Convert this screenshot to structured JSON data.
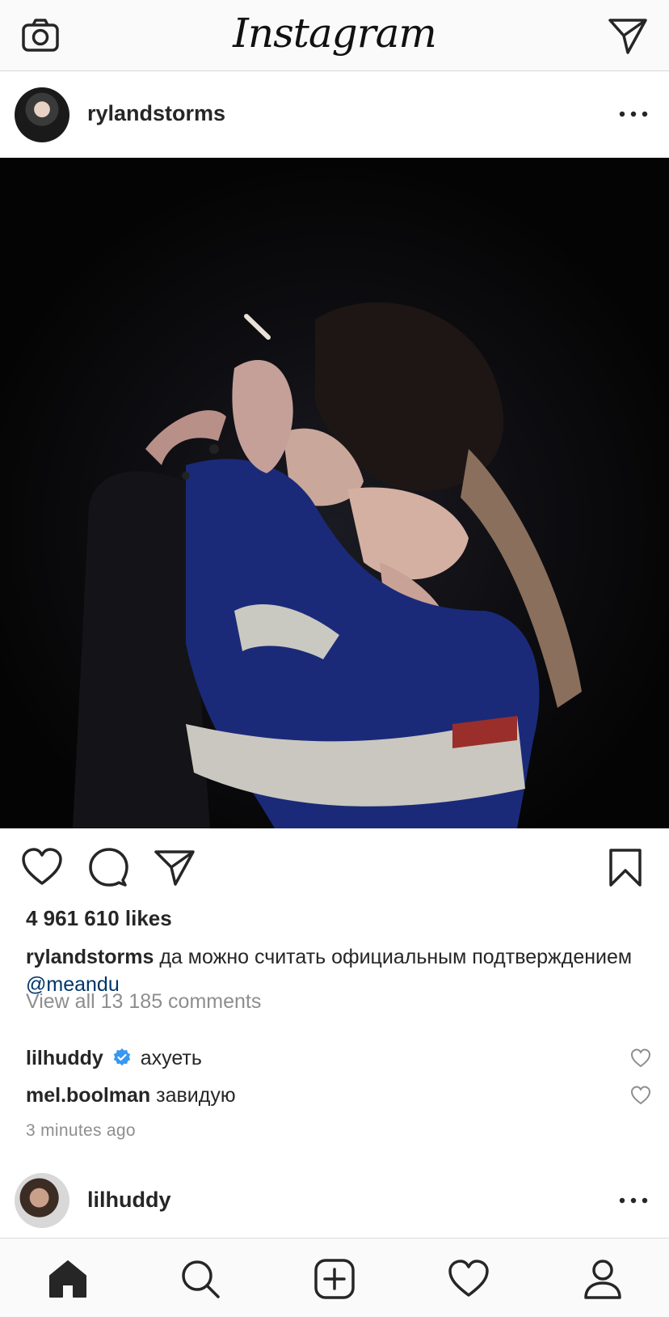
{
  "header": {
    "logo_text": "Instagram",
    "camera_icon": "camera-icon",
    "direct_icon": "paper-plane-icon"
  },
  "post": {
    "username": "rylandstorms",
    "more_icon": "ellipsis-icon",
    "image_description_icon": "photo",
    "likes": "4 961 610 likes",
    "caption": {
      "username": "rylandstorms",
      "text": "да можно считать официальным подтверждением",
      "mention": "@meandu"
    },
    "view_all_comments": "View all 13 185 comments",
    "comments": [
      {
        "username": "lilhuddy",
        "verified": true,
        "text": "ахуеть"
      },
      {
        "username": "mel.boolman",
        "verified": false,
        "text": "завидую"
      }
    ],
    "time_ago": "3 minutes ago"
  },
  "next_post": {
    "username": "lilhuddy"
  },
  "tabbar": {
    "items": [
      "home-icon",
      "search-icon",
      "add-post-icon",
      "activity-heart-icon",
      "profile-icon"
    ]
  },
  "colors": {
    "link": "#003569",
    "secondary_text": "#8e8e8e",
    "verified": "#3897f0",
    "primary_text": "#262626"
  }
}
